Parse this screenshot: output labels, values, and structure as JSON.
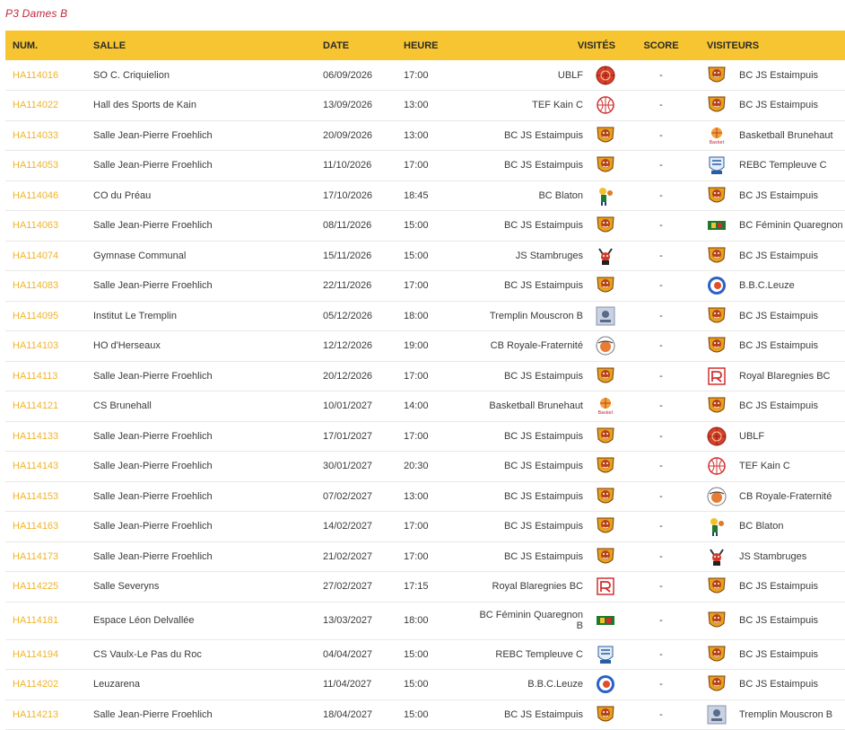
{
  "title": "P3 Dames B",
  "headers": {
    "num": "NUM.",
    "salle": "SALLE",
    "date": "DATE",
    "heure": "HEURE",
    "visites": "VISITÉS",
    "score": "SCORE",
    "visiteurs": "VISITEURS"
  },
  "colors": {
    "header_bg": "#f6c531",
    "link": "#f0b428",
    "title": "#c0263b"
  },
  "logos": {
    "BC JS Estaimpuis": "lion-crest-icon",
    "UBLF": "red-ball-icon",
    "TEF Kain C": "basketball-outline-icon",
    "Basketball Brunehaut": "brunehaut-logo-icon",
    "REBC Templeuve C": "templeuve-crest-icon",
    "BC Blaton": "blaton-mascot-icon",
    "BC Féminin Quaregnon B": "quaregnon-flag-icon",
    "JS Stambruges": "viking-icon",
    "B.B.C.Leuze": "leuze-circle-icon",
    "Tremplin Mouscron B": "tremplin-crest-icon",
    "CB Royale-Fraternité": "fraternite-ball-icon",
    "Royal Blaregnies BC": "blaregnies-logo-icon"
  },
  "rows": [
    {
      "num": "HA114016",
      "salle": "SO C. Criquielion",
      "date": "06/09/2026",
      "heure": "17:00",
      "home": "UBLF",
      "score": "-",
      "away": "BC JS Estaimpuis"
    },
    {
      "num": "HA114022",
      "salle": "Hall des Sports de Kain",
      "date": "13/09/2026",
      "heure": "13:00",
      "home": "TEF Kain C",
      "score": "-",
      "away": "BC JS Estaimpuis"
    },
    {
      "num": "HA114033",
      "salle": "Salle Jean-Pierre Froehlich",
      "date": "20/09/2026",
      "heure": "13:00",
      "home": "BC JS Estaimpuis",
      "score": "-",
      "away": "Basketball Brunehaut"
    },
    {
      "num": "HA114053",
      "salle": "Salle Jean-Pierre Froehlich",
      "date": "11/10/2026",
      "heure": "17:00",
      "home": "BC JS Estaimpuis",
      "score": "-",
      "away": "REBC Templeuve C"
    },
    {
      "num": "HA114046",
      "salle": "CO du Préau",
      "date": "17/10/2026",
      "heure": "18:45",
      "home": "BC Blaton",
      "score": "-",
      "away": "BC JS Estaimpuis"
    },
    {
      "num": "HA114063",
      "salle": "Salle Jean-Pierre Froehlich",
      "date": "08/11/2026",
      "heure": "15:00",
      "home": "BC JS Estaimpuis",
      "score": "-",
      "away": "BC Féminin Quaregnon B"
    },
    {
      "num": "HA114074",
      "salle": "Gymnase Communal",
      "date": "15/11/2026",
      "heure": "15:00",
      "home": "JS Stambruges",
      "score": "-",
      "away": "BC JS Estaimpuis"
    },
    {
      "num": "HA114083",
      "salle": "Salle Jean-Pierre Froehlich",
      "date": "22/11/2026",
      "heure": "17:00",
      "home": "BC JS Estaimpuis",
      "score": "-",
      "away": "B.B.C.Leuze"
    },
    {
      "num": "HA114095",
      "salle": "Institut Le Tremplin",
      "date": "05/12/2026",
      "heure": "18:00",
      "home": "Tremplin Mouscron B",
      "score": "-",
      "away": "BC JS Estaimpuis"
    },
    {
      "num": "HA114103",
      "salle": "HO d'Herseaux",
      "date": "12/12/2026",
      "heure": "19:00",
      "home": "CB Royale-Fraternité",
      "score": "-",
      "away": "BC JS Estaimpuis"
    },
    {
      "num": "HA114113",
      "salle": "Salle Jean-Pierre Froehlich",
      "date": "20/12/2026",
      "heure": "17:00",
      "home": "BC JS Estaimpuis",
      "score": "-",
      "away": "Royal Blaregnies BC"
    },
    {
      "num": "HA114121",
      "salle": "CS Brunehall",
      "date": "10/01/2027",
      "heure": "14:00",
      "home": "Basketball Brunehaut",
      "score": "-",
      "away": "BC JS Estaimpuis"
    },
    {
      "num": "HA114133",
      "salle": "Salle Jean-Pierre Froehlich",
      "date": "17/01/2027",
      "heure": "17:00",
      "home": "BC JS Estaimpuis",
      "score": "-",
      "away": "UBLF"
    },
    {
      "num": "HA114143",
      "salle": "Salle Jean-Pierre Froehlich",
      "date": "30/01/2027",
      "heure": "20:30",
      "home": "BC JS Estaimpuis",
      "score": "-",
      "away": "TEF Kain C"
    },
    {
      "num": "HA114153",
      "salle": "Salle Jean-Pierre Froehlich",
      "date": "07/02/2027",
      "heure": "13:00",
      "home": "BC JS Estaimpuis",
      "score": "-",
      "away": "CB Royale-Fraternité"
    },
    {
      "num": "HA114163",
      "salle": "Salle Jean-Pierre Froehlich",
      "date": "14/02/2027",
      "heure": "17:00",
      "home": "BC JS Estaimpuis",
      "score": "-",
      "away": "BC Blaton"
    },
    {
      "num": "HA114173",
      "salle": "Salle Jean-Pierre Froehlich",
      "date": "21/02/2027",
      "heure": "17:00",
      "home": "BC JS Estaimpuis",
      "score": "-",
      "away": "JS Stambruges"
    },
    {
      "num": "HA114225",
      "salle": "Salle Severyns",
      "date": "27/02/2027",
      "heure": "17:15",
      "home": "Royal Blaregnies BC",
      "score": "-",
      "away": "BC JS Estaimpuis"
    },
    {
      "num": "HA114181",
      "salle": "Espace Léon Delvallée",
      "date": "13/03/2027",
      "heure": "18:00",
      "home": "BC Féminin Quaregnon B",
      "score": "-",
      "away": "BC JS Estaimpuis"
    },
    {
      "num": "HA114194",
      "salle": "CS Vaulx-Le Pas du Roc",
      "date": "04/04/2027",
      "heure": "15:00",
      "home": "REBC Templeuve C",
      "score": "-",
      "away": "BC JS Estaimpuis"
    },
    {
      "num": "HA114202",
      "salle": "Leuzarena",
      "date": "11/04/2027",
      "heure": "15:00",
      "home": "B.B.C.Leuze",
      "score": "-",
      "away": "BC JS Estaimpuis"
    },
    {
      "num": "HA114213",
      "salle": "Salle Jean-Pierre Froehlich",
      "date": "18/04/2027",
      "heure": "15:00",
      "home": "BC JS Estaimpuis",
      "score": "-",
      "away": "Tremplin Mouscron B"
    }
  ]
}
